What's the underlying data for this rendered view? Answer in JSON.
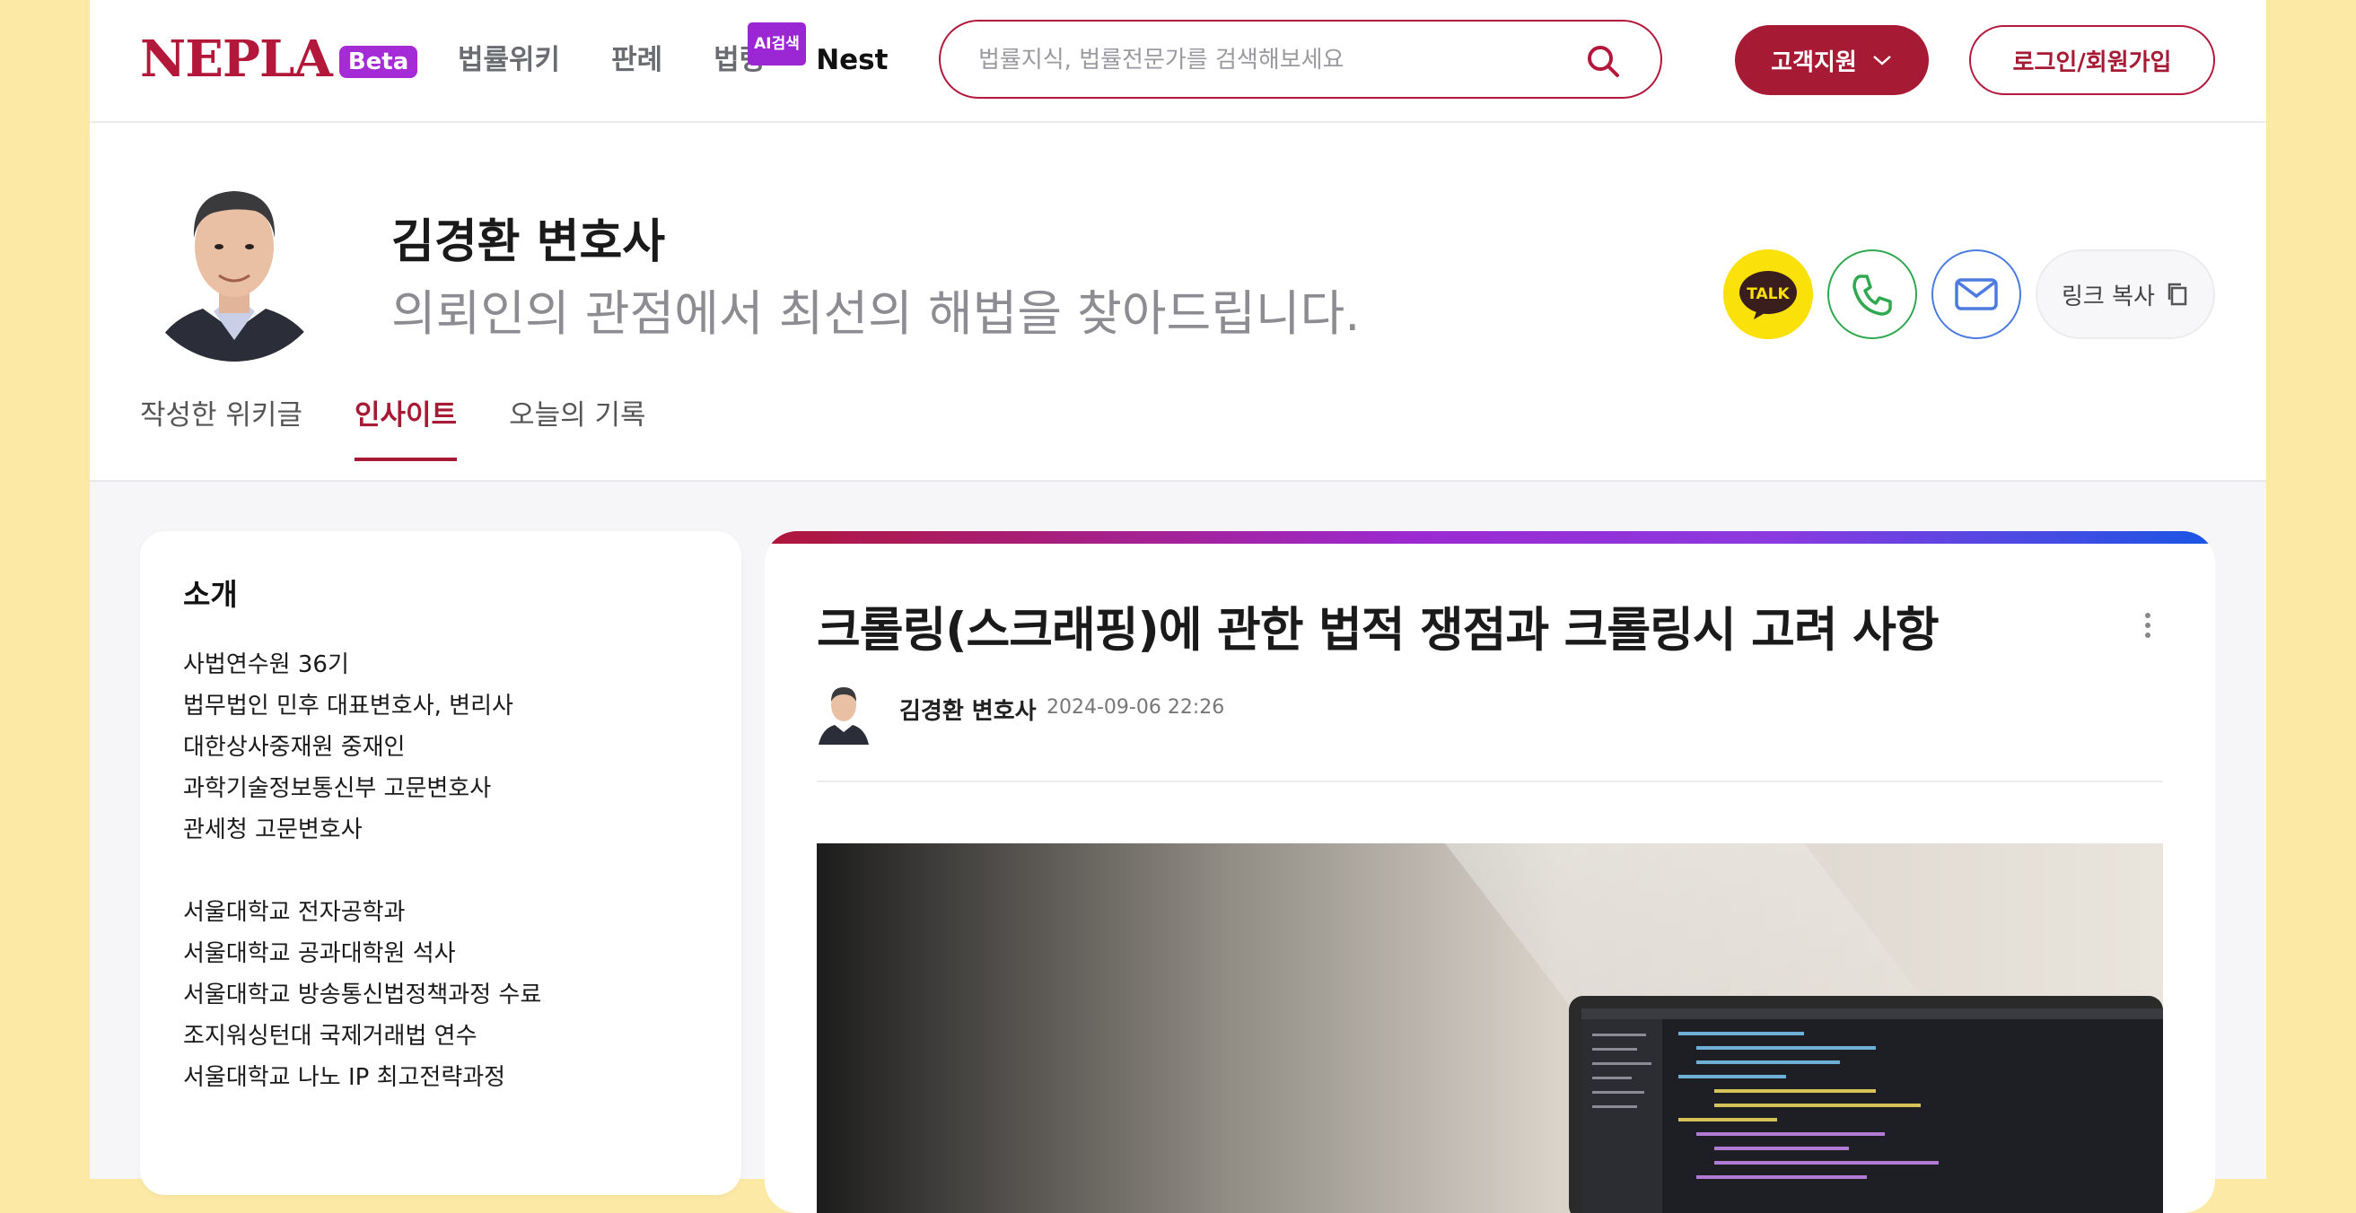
{
  "header": {
    "logo_text": "NEPLA",
    "logo_badge": "Beta",
    "nav": [
      {
        "label": "법률위키"
      },
      {
        "label": "판례"
      },
      {
        "label": "법령",
        "badge": "AI검색"
      },
      {
        "label": "Nest"
      }
    ],
    "search_placeholder": "법률지식, 법률전문가를 검색해보세요",
    "support_label": "고객지원",
    "login_label": "로그인/회원가입"
  },
  "profile": {
    "name": "김경환 변호사",
    "slogan": "의뢰인의 관점에서 최선의 해법을 찾아드립니다.",
    "kakao_label": "TALK",
    "link_copy_label": "링크 복사",
    "tabs": [
      {
        "label": "작성한 위키글",
        "active": false
      },
      {
        "label": "인사이트",
        "active": true
      },
      {
        "label": "오늘의 기록",
        "active": false
      }
    ]
  },
  "intro": {
    "title": "소개",
    "career": [
      "사법연수원 36기",
      "법무법인 민후 대표변호사, 변리사",
      "대한상사중재원 중재인",
      "과학기술정보통신부 고문변호사",
      "관세청 고문변호사"
    ],
    "education": [
      "서울대학교 전자공학과",
      "서울대학교 공과대학원 석사",
      "서울대학교 방송통신법정책과정 수료",
      "조지워싱턴대 국제거래법 연수",
      "서울대학교 나노 IP 최고전략과정"
    ]
  },
  "article": {
    "title": "크롤링(스크래핑)에 관한 법적 쟁점과 크롤링시 고려 사항",
    "author": "김경환 변호사",
    "date": "2024-09-06 22:26"
  },
  "colors": {
    "brand": "#b3173a",
    "support_button": "#a61a34",
    "beta_badge": "#a42bd6",
    "kakao": "#fbe10a",
    "phone": "#2fa84f",
    "mail": "#4b7be0",
    "page_outer": "#fde9a6"
  }
}
